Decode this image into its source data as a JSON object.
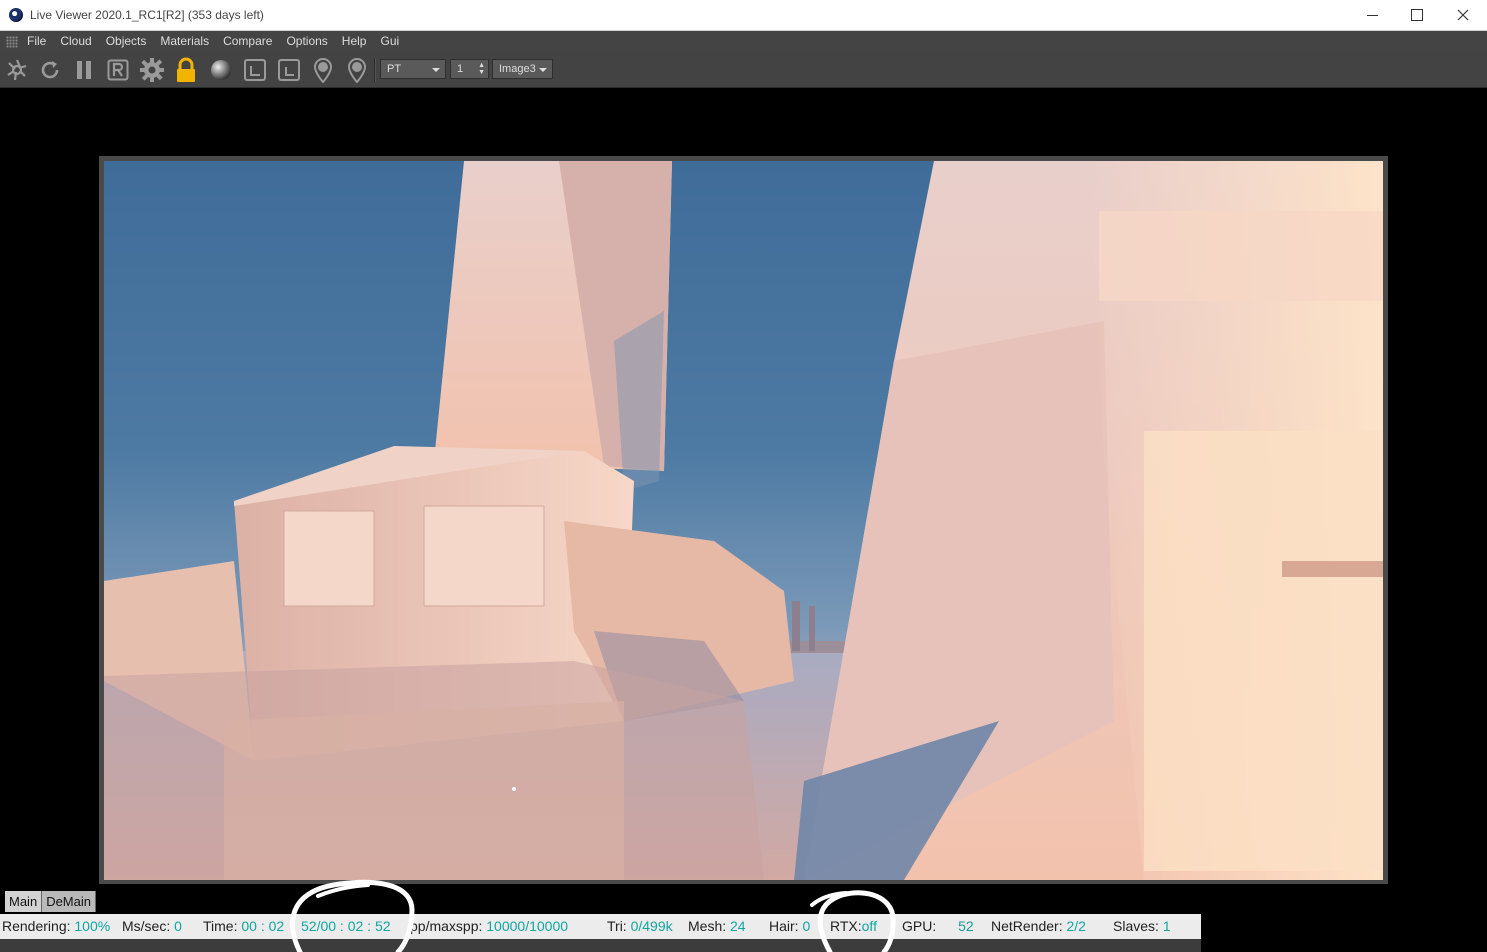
{
  "window": {
    "title": "Live Viewer 2020.1_RC1[R2] (353 days left)",
    "minimize": "minimize",
    "maximize": "maximize",
    "close": "close"
  },
  "menu": {
    "items": [
      "File",
      "Cloud",
      "Objects",
      "Materials",
      "Compare",
      "Options",
      "Help",
      "Gui"
    ]
  },
  "toolbar": {
    "icons": [
      "aperture-icon",
      "refresh-icon",
      "pause-icon",
      "region-render-icon",
      "settings-gear-icon",
      "lock-icon",
      "material-sphere-icon",
      "frame-icon",
      "frame-alt-icon",
      "focus-pin-icon",
      "material-pin-icon"
    ],
    "kernel_value": "PT",
    "spinner_value": "1",
    "image_value": "Image3"
  },
  "tabs": [
    "Main",
    "DeMain"
  ],
  "status": {
    "rendering_label": "Rendering:",
    "rendering_value": "100%",
    "mssec_label": "Ms/sec:",
    "mssec_value": "0",
    "time_label": "Time:",
    "time_value_a": "00 : 02",
    "time_value_b": "52/00 : 02 : 52",
    "spp_label": "pp/maxspp:",
    "spp_value": "10000/10000",
    "tri_label": "Tri:",
    "tri_value": "0/499k",
    "mesh_label": "Mesh:",
    "mesh_value": "24",
    "hair_label": "Hair:",
    "hair_value": "0",
    "rtx_label": "RTX:",
    "rtx_value": "off",
    "gpu_label": "GPU:",
    "gpu_value": "52",
    "netrender_label": "NetRender:",
    "netrender_value": "2/2",
    "slaves_label": "Slaves:",
    "slaves_value": "1"
  },
  "colors": {
    "accent_status": "#10a7a0",
    "lock": "#f2b400",
    "annotation": "#ffffff"
  }
}
